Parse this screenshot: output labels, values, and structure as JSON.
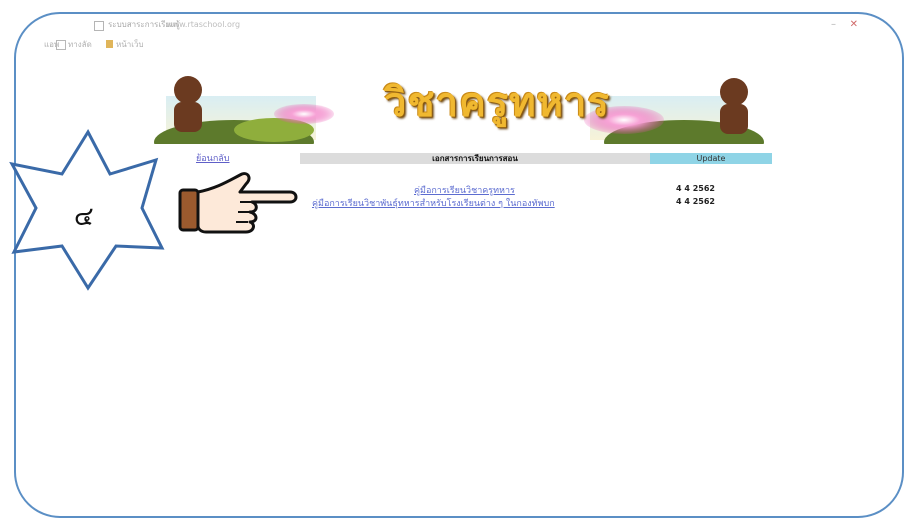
{
  "browser": {
    "tab_title": "ระบบสาระการเรียนรู้",
    "address": "www.rtaschool.org",
    "bookmarks": [
      {
        "label": "แอพ"
      },
      {
        "label": "ทางลัด"
      },
      {
        "label": "หน้าเว็บ"
      }
    ],
    "window_min": "–",
    "window_close": "✕"
  },
  "banner": {
    "title": "วิชาครูทหาร"
  },
  "nav": {
    "home_link": "ย้อนกลับ",
    "header_title": "เอกสารการเรียนการสอน",
    "update_label": "Update"
  },
  "documents": [
    {
      "title": "คู่มือการเรียนวิชาครูทหาร",
      "date": "4 4 2562"
    },
    {
      "title": "คู่มือการเรียนวิชาพันธุ์ทหารสำหรับโรงเรียนต่าง ๆ ในกองทัพบก",
      "date": "4 4 2562"
    }
  ],
  "badge": {
    "number": "๔"
  },
  "colors": {
    "frame": "#5b8fc5",
    "link": "#5c6cd0",
    "update_bar": "#8fd4e6",
    "header_bar": "#dcdcdc",
    "banner_title": "#f0b830"
  }
}
